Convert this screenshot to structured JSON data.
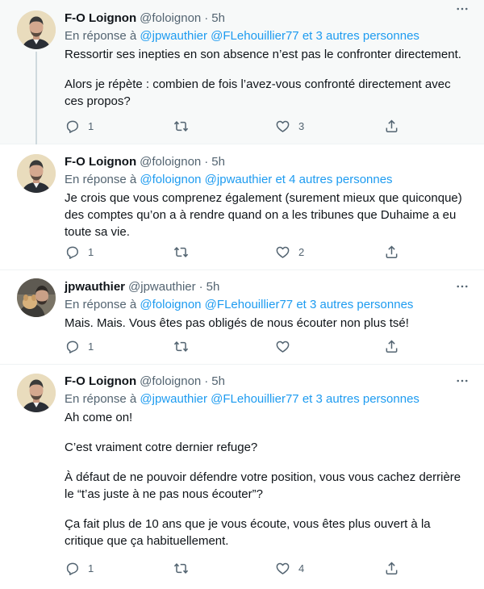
{
  "tweets": [
    {
      "name": "F-O Loignon",
      "handle": "@foloignon",
      "dot": "·",
      "time": "5h",
      "reply_prefix": "En réponse à",
      "reply_mentions": "@jpwauthier @FLehouillier77",
      "reply_others": "et 3 autres personnes",
      "paragraphs": [
        "Ressortir ses inepties en son absence n’est pas le confronter directement.",
        "Alors je répète : combien de fois l’avez-vous confronté directement avec ces propos?"
      ],
      "reply_count": "1",
      "retweet_count": "",
      "like_count": "3",
      "avatar_icon": "avatar-foloignon"
    },
    {
      "name": "F-O Loignon",
      "handle": "@foloignon",
      "dot": "·",
      "time": "5h",
      "reply_prefix": "En réponse à",
      "reply_mentions": "@foloignon @jpwauthier",
      "reply_others": "et 4 autres personnes",
      "paragraphs": [
        "Je crois que vous comprenez également (surement mieux que quiconque) des comptes qu’on a à rendre quand on a les tribunes que Duhaime a eu toute sa vie."
      ],
      "reply_count": "1",
      "retweet_count": "",
      "like_count": "2",
      "avatar_icon": "avatar-foloignon"
    },
    {
      "name": "jpwauthier",
      "handle": "@jpwauthier",
      "dot": "·",
      "time": "5h",
      "reply_prefix": "En réponse à",
      "reply_mentions": "@foloignon @FLehouillier77",
      "reply_others": "et 3 autres personnes",
      "paragraphs": [
        "Mais. Mais. Vous êtes pas obligés de nous écouter non plus tsé!"
      ],
      "reply_count": "1",
      "retweet_count": "",
      "like_count": "",
      "avatar_icon": "avatar-jpwauthier"
    },
    {
      "name": "F-O Loignon",
      "handle": "@foloignon",
      "dot": "·",
      "time": "5h",
      "reply_prefix": "En réponse à",
      "reply_mentions": "@jpwauthier @FLehouillier77",
      "reply_others": "et 3 autres personnes",
      "paragraphs": [
        "Ah come on!",
        "C’est vraiment cotre dernier refuge?",
        "À défaut de ne pouvoir défendre votre position, vous vous cachez derrière le “t’as juste à ne pas nous écouter”?",
        "Ça fait plus de 10 ans que je vous écoute, vous êtes plus ouvert à la critique que ça habituellement."
      ],
      "reply_count": "1",
      "retweet_count": "",
      "like_count": "4",
      "avatar_icon": "avatar-foloignon"
    }
  ],
  "icons": {
    "more": "more-dots-icon",
    "reply": "reply-bubble-icon",
    "retweet": "retweet-icon",
    "like": "heart-icon",
    "share": "share-upload-icon"
  },
  "colors": {
    "link": "#1d9bf0",
    "secondary": "#536471",
    "thread_line": "#cfd9de",
    "highlight_bg": "#f7f9f9"
  }
}
